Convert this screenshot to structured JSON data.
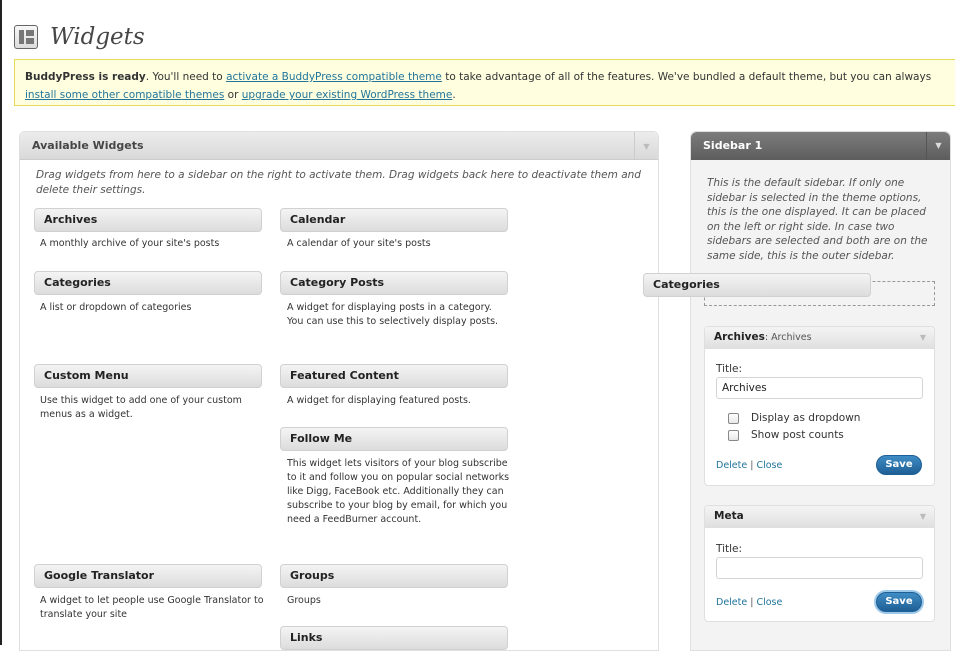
{
  "page": {
    "title": "Widgets"
  },
  "notice": {
    "bold": "BuddyPress is ready",
    "text1": ". You'll need to ",
    "link1": "activate a BuddyPress compatible theme",
    "text2": " to take advantage of all of the features. We've bundled a default theme, but you can always ",
    "link2": "install some other compatible themes",
    "text3": " or ",
    "link3": "upgrade your existing WordPress theme",
    "text4": "."
  },
  "available": {
    "title": "Available Widgets",
    "description": "Drag widgets from here to a sidebar on the right to activate them. Drag widgets back here to deactivate them and delete their settings.",
    "widgets": [
      {
        "title": "Archives",
        "desc": "A monthly archive of your site's posts"
      },
      {
        "title": "Calendar",
        "desc": "A calendar of your site's posts"
      },
      {
        "title": "Categories",
        "desc": "A list or dropdown of categories"
      },
      {
        "title": "Category Posts",
        "desc": "A widget for displaying posts in a category. You can use this to selectively display posts."
      },
      {
        "title": "Custom Menu",
        "desc": "Use this widget to add one of your custom menus as a widget."
      },
      {
        "title": "Featured Content",
        "desc": "A widget for displaying featured posts."
      },
      {
        "title": "Follow Me",
        "desc": "This widget lets visitors of your blog subscribe to it and follow you on popular social networks like Digg, FaceBook etc. Additionally they can subscribe to your blog by email, for which you need a FeedBurner account."
      },
      {
        "title": "Google Translator",
        "desc": "A widget to let people use Google Translator to translate your site"
      },
      {
        "title": "Groups",
        "desc": "Groups"
      },
      {
        "title": "Links",
        "desc": ""
      }
    ]
  },
  "sidebar": {
    "title": "Sidebar 1",
    "description": "This is the default sidebar. If only one sidebar is selected in the theme options, this is the one displayed. It can be placed on the left or right side. In case two sidebars are selected and both are on the same side, this is the outer sidebar.",
    "dragging": "Categories",
    "archives": {
      "name": "Archives",
      "sep": ": ",
      "instance": "Archives",
      "title_label": "Title:",
      "title_value": "Archives",
      "opt1": "Display as dropdown",
      "opt2": "Show post counts",
      "delete": "Delete",
      "pipe": " | ",
      "close": "Close",
      "save": "Save"
    },
    "meta": {
      "name": "Meta",
      "title_label": "Title:",
      "title_value": "",
      "delete": "Delete",
      "pipe": " | ",
      "close": "Close",
      "save": "Save"
    }
  },
  "icons": {
    "arrow": "▼"
  }
}
